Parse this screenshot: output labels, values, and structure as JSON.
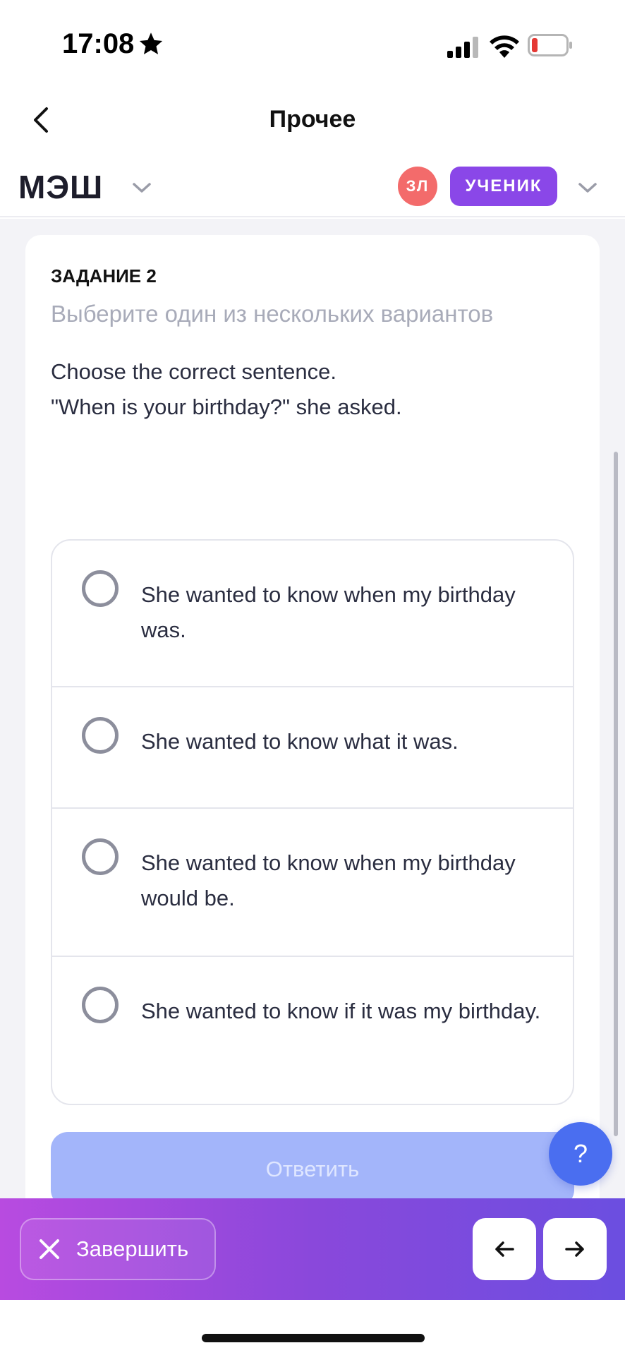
{
  "status_bar": {
    "time": "17:08",
    "icons": [
      "star-icon",
      "signal-icon",
      "wifi-icon",
      "battery-icon"
    ],
    "battery_color": "#e53935"
  },
  "nav": {
    "back_icon": "chevron-left-icon",
    "title": "Прочее"
  },
  "app_header": {
    "logo": "МЭШ",
    "avatar_initials": "ЗЛ",
    "avatar_color": "#f36b6b",
    "role": "УЧЕНИК",
    "role_color": "#8a47e8"
  },
  "task": {
    "label": "ЗАДАНИЕ 2",
    "hint": "Выберите один из нескольких вариантов",
    "question": "Choose the correct sentence.\n\"When is your birthday?\" she asked.",
    "options": [
      {
        "text": "She wanted to know when my birthday was.",
        "selected": false
      },
      {
        "text": "She wanted to know what it was.",
        "selected": false
      },
      {
        "text": "She wanted to know when my birthday would be.",
        "selected": false
      },
      {
        "text": "She wanted to know if it was my birthday.",
        "selected": false
      }
    ],
    "submit_label": "Ответить",
    "help_label": "?"
  },
  "bottom_bar": {
    "finish_label": "Завершить",
    "prev_icon": "arrow-left-icon",
    "next_icon": "arrow-right-icon"
  }
}
